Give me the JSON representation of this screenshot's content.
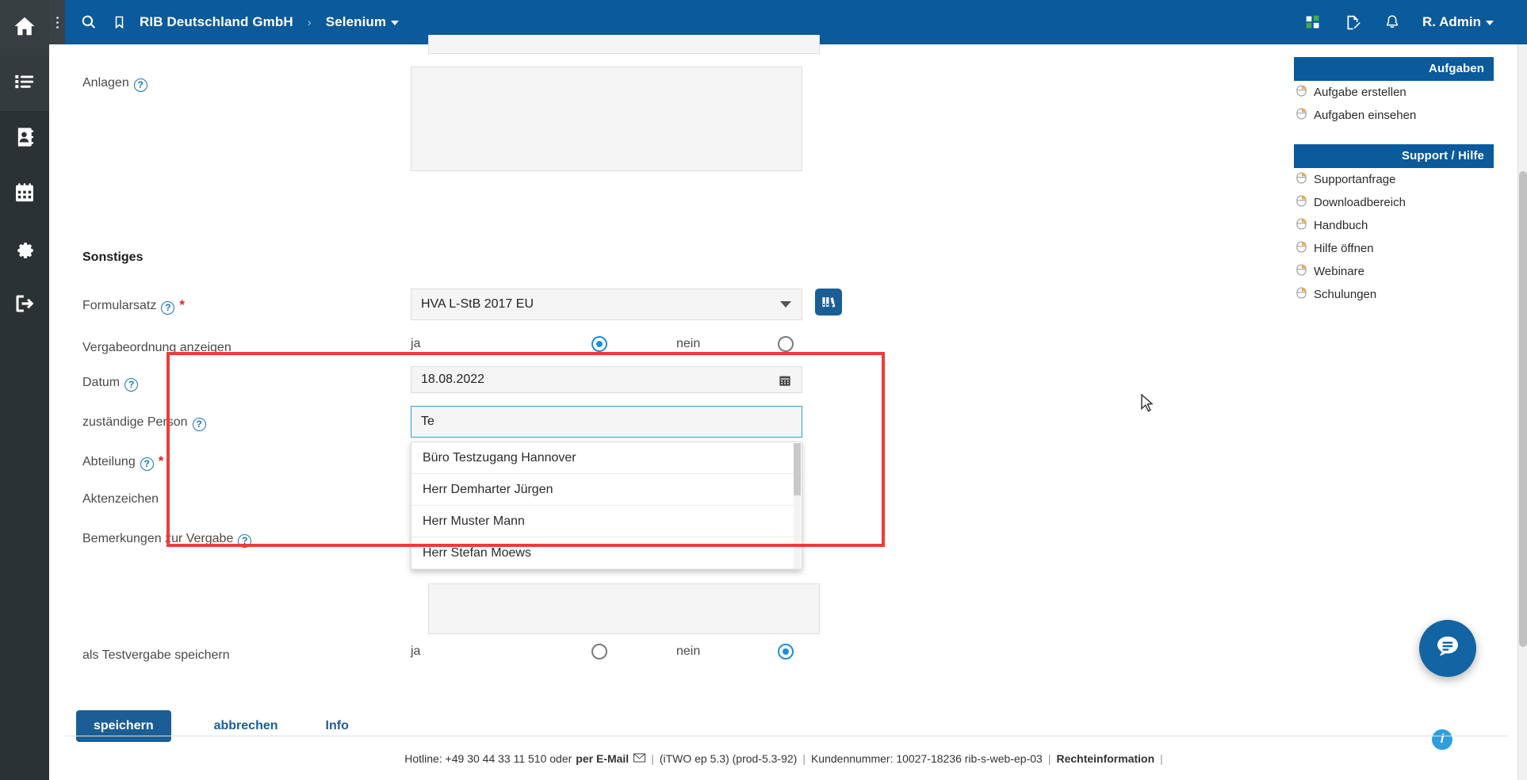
{
  "sidebar": {
    "items": [
      {
        "name": "home",
        "icon": "home-icon",
        "active": true
      },
      {
        "name": "list",
        "icon": "list-icon",
        "active": false
      },
      {
        "name": "contacts",
        "icon": "address-book-icon",
        "active": false
      },
      {
        "name": "calendar",
        "icon": "calendar-icon",
        "active": false
      },
      {
        "name": "settings",
        "icon": "gear-icon",
        "active": false
      },
      {
        "name": "logout",
        "icon": "logout-icon",
        "active": false
      }
    ]
  },
  "topbar": {
    "search_icon": "search-icon",
    "bookmark_icon": "bookmark-icon",
    "company": "RIB Deutschland GmbH",
    "separator": "›",
    "project": "Selenium",
    "apps_icon": "apps-grid-icon",
    "notes_icon": "note-edit-icon",
    "bell_icon": "bell-icon",
    "user": "R. Admin"
  },
  "form": {
    "attachments_label": "Anlagen",
    "section_title": "Sonstiges",
    "formularsatz": {
      "label": "Formularsatz",
      "required": "*",
      "value": "HVA L-StB 2017 EU",
      "button_icon": "binders-icon"
    },
    "vergabeordnung": {
      "label": "Vergabeordnung anzeigen",
      "yes": "ja",
      "no": "nein",
      "selected": "ja"
    },
    "datum": {
      "label": "Datum",
      "value": "18.08.2022",
      "icon": "calendar-icon"
    },
    "zustaendige_person": {
      "label": "zuständige Person",
      "value": "Te",
      "suggestions": [
        "Büro Testzugang Hannover",
        "Herr Demharter Jürgen",
        "Herr Muster Mann",
        "Herr Stefan Moews"
      ]
    },
    "abteilung": {
      "label": "Abteilung",
      "required": "*",
      "value": ""
    },
    "aktenzeichen": {
      "label": "Aktenzeichen",
      "value": ""
    },
    "bemerkungen": {
      "label": "Bemerkungen zur Vergabe",
      "value": ""
    },
    "testvergabe": {
      "label": "als Testvergabe speichern",
      "yes": "ja",
      "no": "nein",
      "selected": "nein"
    },
    "buttons": {
      "save": "speichern",
      "cancel": "abbrechen",
      "info": "Info"
    }
  },
  "right_panel": {
    "tasks_header": "Aufgaben",
    "tasks_items": [
      "Aufgabe erstellen",
      "Aufgaben einsehen"
    ],
    "support_header": "Support / Hilfe",
    "support_items": [
      "Supportanfrage",
      "Downloadbereich",
      "Handbuch",
      "Hilfe öffnen",
      "Webinare",
      "Schulungen"
    ]
  },
  "widgets": {
    "chat_icon": "chat-bubble-icon",
    "info_icon": "info-icon"
  },
  "footer": {
    "hotline": "Hotline: +49 30 44 33 11 510 oder",
    "email_link": "per E-Mail",
    "email_icon": "envelope-icon",
    "version": "(iTWO ep 5.3) (prod-5.3-92)",
    "customer": "Kundennummer: 10027-18236 rib-s-web-ep-03",
    "legal": "Rechteinformation",
    "sep": "|"
  },
  "colors": {
    "brand_blue": "#0a5a9c",
    "accent_blue": "#1f8fd4",
    "highlight_red": "#ef3b3b",
    "rail_dark": "#2b3235"
  }
}
